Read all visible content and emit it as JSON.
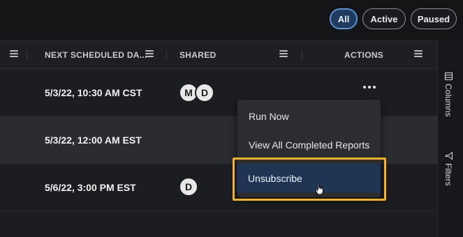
{
  "filters": [
    {
      "label": "All",
      "active": true
    },
    {
      "label": "Active",
      "active": false
    },
    {
      "label": "Paused",
      "active": false
    }
  ],
  "columns": {
    "next_scheduled": "NEXT SCHEDULED DA...",
    "shared": "SHARED",
    "actions": "ACTIONS"
  },
  "rows": [
    {
      "date": "5/3/22, 10:30 AM CST",
      "avatars": [
        "M",
        "D"
      ]
    },
    {
      "date": "5/3/22, 12:00 AM EST",
      "avatars": []
    },
    {
      "date": "5/6/22, 3:00 PM EST",
      "avatars": [
        "D"
      ]
    }
  ],
  "sidebar": {
    "columns_label": "Columns",
    "filters_label": "Filters"
  },
  "action_menu": {
    "items": [
      "Run Now",
      "View All Completed Reports",
      "Unsubscribe"
    ],
    "highlighted_index": 2
  },
  "colors": {
    "highlight_frame": "#f2b31b",
    "active_pill": "#1e3a5f",
    "menu_highlight": "#1f3553"
  }
}
